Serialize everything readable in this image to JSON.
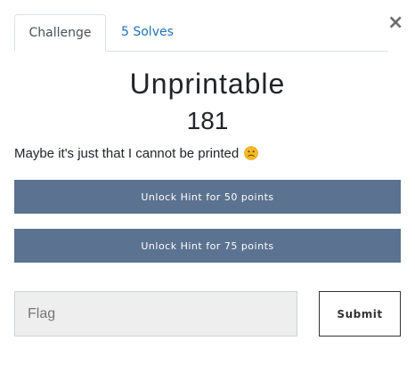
{
  "tabs": [
    {
      "label": "Challenge",
      "active": true
    },
    {
      "label": "5 Solves",
      "active": false
    }
  ],
  "close": {
    "label": "×"
  },
  "challenge": {
    "name": "Unprintable",
    "points": "181",
    "description": "Maybe it's just that I cannot be printed",
    "description_emoji": "slightly-frowning-face"
  },
  "hints": [
    {
      "label": "Unlock Hint for 50 points"
    },
    {
      "label": "Unlock Hint for 75 points"
    }
  ],
  "flag_input": {
    "placeholder": "Flag",
    "value": ""
  },
  "submit": {
    "label": "Submit"
  },
  "colors": {
    "hint_button_bg": "#5b7290",
    "tab_link": "#1f72b8",
    "input_bg": "#eeeeee",
    "emoji_face": "#f5b921"
  }
}
